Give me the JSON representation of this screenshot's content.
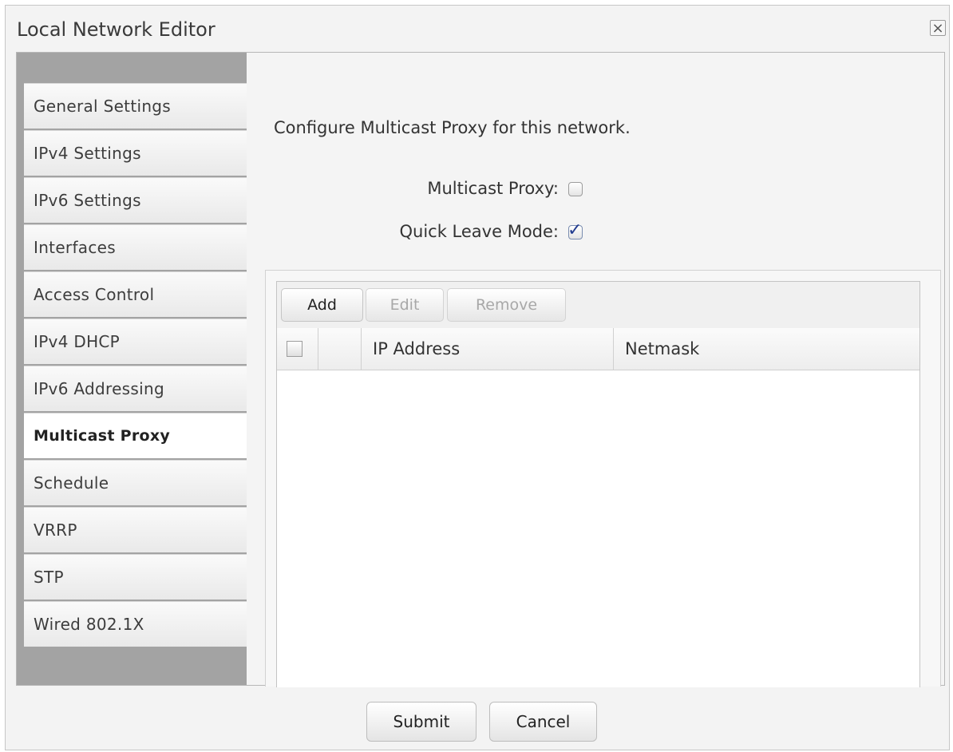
{
  "dialog": {
    "title": "Local Network Editor",
    "close_glyph": "×"
  },
  "sidebar": {
    "items": [
      {
        "label": "General Settings"
      },
      {
        "label": "IPv4 Settings"
      },
      {
        "label": "IPv6 Settings"
      },
      {
        "label": "Interfaces"
      },
      {
        "label": "Access Control"
      },
      {
        "label": "IPv4 DHCP"
      },
      {
        "label": "IPv6 Addressing"
      },
      {
        "label": "Multicast Proxy",
        "active": true
      },
      {
        "label": "Schedule"
      },
      {
        "label": "VRRP"
      },
      {
        "label": "STP"
      },
      {
        "label": "Wired 802.1X"
      }
    ]
  },
  "main": {
    "description": "Configure Multicast Proxy for this network.",
    "multicast_proxy": {
      "label": "Multicast Proxy:",
      "checked": false
    },
    "quick_leave": {
      "label": "Quick Leave Mode:",
      "checked": true,
      "check_glyph": "✓"
    }
  },
  "grid": {
    "toolbar": {
      "add": "Add",
      "edit": "Edit",
      "remove": "Remove"
    },
    "columns": [
      "IP Address",
      "Netmask"
    ],
    "rows": []
  },
  "footer": {
    "submit": "Submit",
    "cancel": "Cancel"
  },
  "colors": {
    "sidebar_bg": "#a3a3a3",
    "check_color": "#213b8f"
  }
}
